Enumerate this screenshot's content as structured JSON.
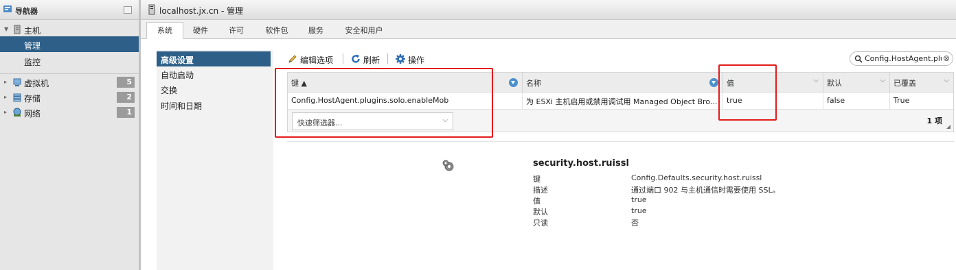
{
  "navigator": {
    "title": "导航器",
    "host": {
      "label": "主机",
      "children": [
        {
          "label": "管理",
          "selected": true
        },
        {
          "label": "监控"
        }
      ]
    },
    "items": [
      {
        "label": "虚拟机",
        "badge": "5",
        "icon": "vm-icon"
      },
      {
        "label": "存储",
        "badge": "2",
        "icon": "storage-icon"
      },
      {
        "label": "网络",
        "badge": "1",
        "icon": "network-icon"
      }
    ]
  },
  "window": {
    "title": "localhost.jx.cn - 管理"
  },
  "tabs": [
    {
      "label": "系统",
      "active": true
    },
    {
      "label": "硬件"
    },
    {
      "label": "许可"
    },
    {
      "label": "软件包"
    },
    {
      "label": "服务"
    },
    {
      "label": "安全和用户"
    }
  ],
  "left_menu": [
    {
      "label": "高级设置",
      "selected": true
    },
    {
      "label": "自动启动"
    },
    {
      "label": "交换"
    },
    {
      "label": "时间和日期"
    }
  ],
  "toolbar": {
    "edit_label": "编辑选项",
    "refresh_label": "刷新",
    "actions_label": "操作"
  },
  "search": {
    "value": "Config.HostAgent.plugins"
  },
  "grid": {
    "columns": [
      "键 ▲",
      "名称",
      "值",
      "默认",
      "已覆盖"
    ],
    "rows": [
      [
        "Config.HostAgent.plugins.solo.enableMob",
        "为 ESXi 主机启用或禁用调试用 Managed Object Bro...",
        "true",
        "false",
        "True"
      ]
    ],
    "quick_filter_placeholder": "快速筛选器...",
    "item_count": "1 项"
  },
  "details": {
    "title": "security.host.ruissl",
    "fields": [
      {
        "label": "键",
        "value": "Config.Defaults.security.host.ruissl"
      },
      {
        "label": "描述",
        "value": "通过端口 902 与主机通信时需要使用 SSL。"
      },
      {
        "label": "值",
        "value": "true"
      },
      {
        "label": "默认",
        "value": "true"
      },
      {
        "label": "只读",
        "value": "否"
      }
    ]
  },
  "colors": {
    "selection": "#2d5f88",
    "annotation": "#e31b1b",
    "accent": "#4a90cc"
  }
}
